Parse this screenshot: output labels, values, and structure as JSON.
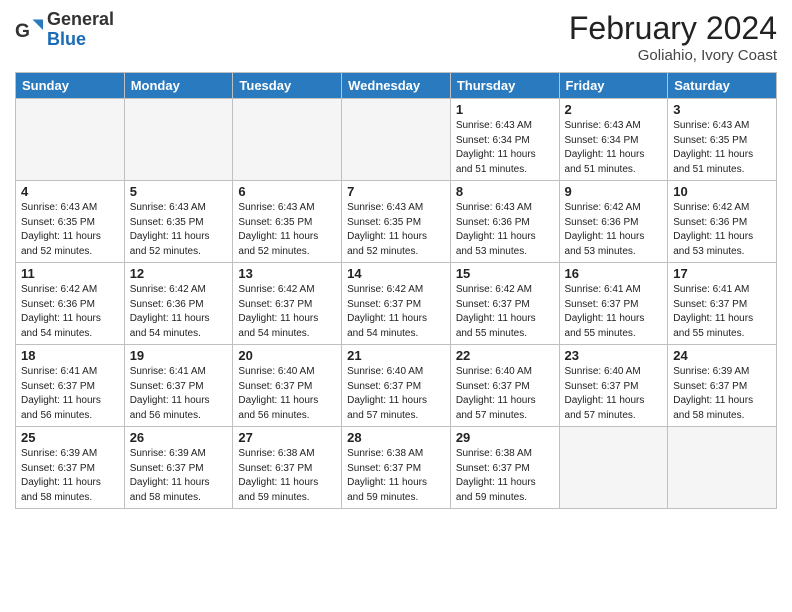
{
  "header": {
    "logo_general": "General",
    "logo_blue": "Blue",
    "month_year": "February 2024",
    "location": "Goliahio, Ivory Coast"
  },
  "days_of_week": [
    "Sunday",
    "Monday",
    "Tuesday",
    "Wednesday",
    "Thursday",
    "Friday",
    "Saturday"
  ],
  "weeks": [
    [
      {
        "day": "",
        "info": ""
      },
      {
        "day": "",
        "info": ""
      },
      {
        "day": "",
        "info": ""
      },
      {
        "day": "",
        "info": ""
      },
      {
        "day": "1",
        "info": "Sunrise: 6:43 AM\nSunset: 6:34 PM\nDaylight: 11 hours\nand 51 minutes."
      },
      {
        "day": "2",
        "info": "Sunrise: 6:43 AM\nSunset: 6:34 PM\nDaylight: 11 hours\nand 51 minutes."
      },
      {
        "day": "3",
        "info": "Sunrise: 6:43 AM\nSunset: 6:35 PM\nDaylight: 11 hours\nand 51 minutes."
      }
    ],
    [
      {
        "day": "4",
        "info": "Sunrise: 6:43 AM\nSunset: 6:35 PM\nDaylight: 11 hours\nand 52 minutes."
      },
      {
        "day": "5",
        "info": "Sunrise: 6:43 AM\nSunset: 6:35 PM\nDaylight: 11 hours\nand 52 minutes."
      },
      {
        "day": "6",
        "info": "Sunrise: 6:43 AM\nSunset: 6:35 PM\nDaylight: 11 hours\nand 52 minutes."
      },
      {
        "day": "7",
        "info": "Sunrise: 6:43 AM\nSunset: 6:35 PM\nDaylight: 11 hours\nand 52 minutes."
      },
      {
        "day": "8",
        "info": "Sunrise: 6:43 AM\nSunset: 6:36 PM\nDaylight: 11 hours\nand 53 minutes."
      },
      {
        "day": "9",
        "info": "Sunrise: 6:42 AM\nSunset: 6:36 PM\nDaylight: 11 hours\nand 53 minutes."
      },
      {
        "day": "10",
        "info": "Sunrise: 6:42 AM\nSunset: 6:36 PM\nDaylight: 11 hours\nand 53 minutes."
      }
    ],
    [
      {
        "day": "11",
        "info": "Sunrise: 6:42 AM\nSunset: 6:36 PM\nDaylight: 11 hours\nand 54 minutes."
      },
      {
        "day": "12",
        "info": "Sunrise: 6:42 AM\nSunset: 6:36 PM\nDaylight: 11 hours\nand 54 minutes."
      },
      {
        "day": "13",
        "info": "Sunrise: 6:42 AM\nSunset: 6:37 PM\nDaylight: 11 hours\nand 54 minutes."
      },
      {
        "day": "14",
        "info": "Sunrise: 6:42 AM\nSunset: 6:37 PM\nDaylight: 11 hours\nand 54 minutes."
      },
      {
        "day": "15",
        "info": "Sunrise: 6:42 AM\nSunset: 6:37 PM\nDaylight: 11 hours\nand 55 minutes."
      },
      {
        "day": "16",
        "info": "Sunrise: 6:41 AM\nSunset: 6:37 PM\nDaylight: 11 hours\nand 55 minutes."
      },
      {
        "day": "17",
        "info": "Sunrise: 6:41 AM\nSunset: 6:37 PM\nDaylight: 11 hours\nand 55 minutes."
      }
    ],
    [
      {
        "day": "18",
        "info": "Sunrise: 6:41 AM\nSunset: 6:37 PM\nDaylight: 11 hours\nand 56 minutes."
      },
      {
        "day": "19",
        "info": "Sunrise: 6:41 AM\nSunset: 6:37 PM\nDaylight: 11 hours\nand 56 minutes."
      },
      {
        "day": "20",
        "info": "Sunrise: 6:40 AM\nSunset: 6:37 PM\nDaylight: 11 hours\nand 56 minutes."
      },
      {
        "day": "21",
        "info": "Sunrise: 6:40 AM\nSunset: 6:37 PM\nDaylight: 11 hours\nand 57 minutes."
      },
      {
        "day": "22",
        "info": "Sunrise: 6:40 AM\nSunset: 6:37 PM\nDaylight: 11 hours\nand 57 minutes."
      },
      {
        "day": "23",
        "info": "Sunrise: 6:40 AM\nSunset: 6:37 PM\nDaylight: 11 hours\nand 57 minutes."
      },
      {
        "day": "24",
        "info": "Sunrise: 6:39 AM\nSunset: 6:37 PM\nDaylight: 11 hours\nand 58 minutes."
      }
    ],
    [
      {
        "day": "25",
        "info": "Sunrise: 6:39 AM\nSunset: 6:37 PM\nDaylight: 11 hours\nand 58 minutes."
      },
      {
        "day": "26",
        "info": "Sunrise: 6:39 AM\nSunset: 6:37 PM\nDaylight: 11 hours\nand 58 minutes."
      },
      {
        "day": "27",
        "info": "Sunrise: 6:38 AM\nSunset: 6:37 PM\nDaylight: 11 hours\nand 59 minutes."
      },
      {
        "day": "28",
        "info": "Sunrise: 6:38 AM\nSunset: 6:37 PM\nDaylight: 11 hours\nand 59 minutes."
      },
      {
        "day": "29",
        "info": "Sunrise: 6:38 AM\nSunset: 6:37 PM\nDaylight: 11 hours\nand 59 minutes."
      },
      {
        "day": "",
        "info": ""
      },
      {
        "day": "",
        "info": ""
      }
    ]
  ]
}
